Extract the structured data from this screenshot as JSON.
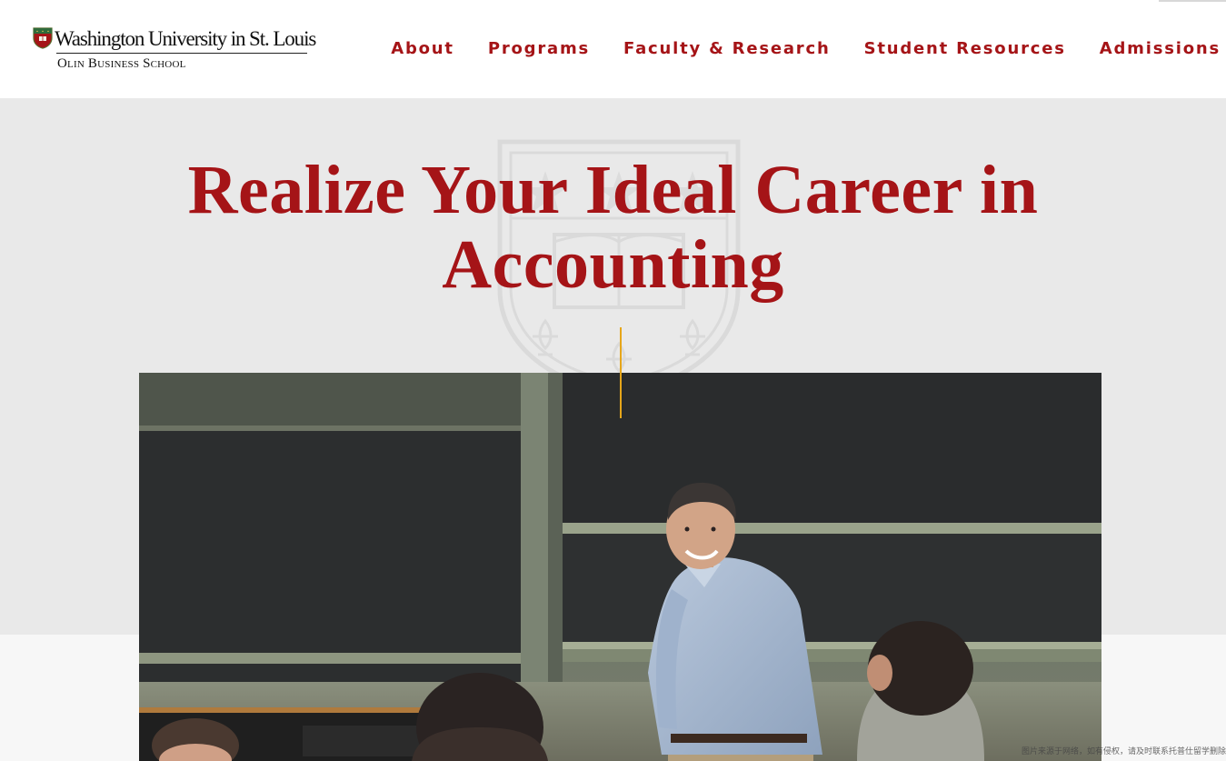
{
  "header": {
    "logo": {
      "university": "Washington University in St. Louis",
      "school": "Olin Business School"
    },
    "nav": [
      {
        "label": "About"
      },
      {
        "label": "Programs"
      },
      {
        "label": "Faculty & Research"
      },
      {
        "label": "Student Resources"
      },
      {
        "label": "Admissions"
      }
    ]
  },
  "hero": {
    "title": "Realize Your Ideal Career in Accounting"
  },
  "photo": {
    "subject": "Instructor smiling in front of chalkboards in a classroom with students"
  },
  "credit": "图片来源于网络，如有侵权，请及时联系托普仕留学删除",
  "colors": {
    "brand_red": "#a51417",
    "accent_gold": "#e6a61a",
    "hero_bg": "#e9e9e9"
  }
}
